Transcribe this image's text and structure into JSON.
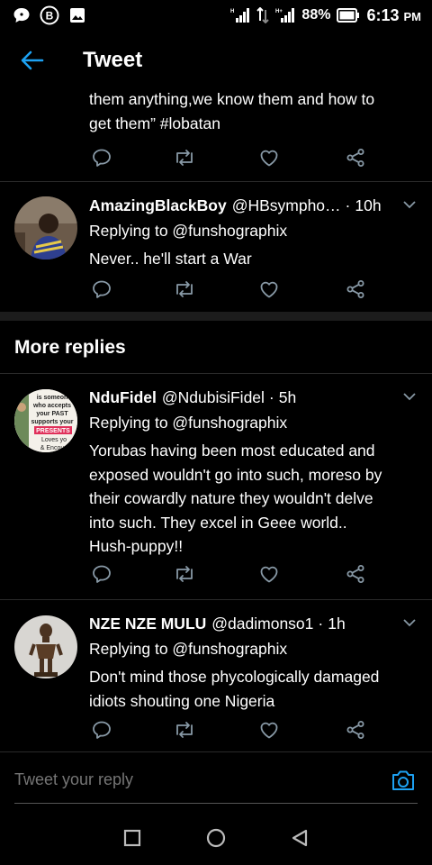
{
  "status_bar": {
    "battery_pct": "88%",
    "time": "6:13",
    "ampm": "PM"
  },
  "header": {
    "title": "Tweet"
  },
  "top_tweet": {
    "text_lines": [
      "them anything,we know them and how to",
      "get them” #lobatan"
    ]
  },
  "tweets": [
    {
      "name": "AmazingBlackBoy",
      "handle": "@HBsympho…",
      "time": "10h",
      "reply_to": "Replying to @funshographix",
      "text_lines": [
        "Never.. he'll start a War"
      ]
    },
    {
      "name": "NduFidel",
      "handle": "@NdubisiFidel",
      "time": "5h",
      "reply_to": "Replying to @funshographix",
      "text_lines": [
        "Yorubas having been most educated and",
        "exposed wouldn't go into such, moreso by",
        "their cowardly nature they wouldn't delve",
        "into such. They excel in Geee world..",
        "Hush-puppy!!"
      ],
      "avatar_text": [
        "is someon",
        "who accepts",
        "your PAST",
        "supports your",
        "PRESENTS",
        "Loves yo",
        "& Encou"
      ]
    },
    {
      "name": "NZE NZE MULU",
      "handle": "@dadimonso1",
      "time": "1h",
      "reply_to": "Replying to @funshographix",
      "text_lines": [
        "Don't mind those phycologically damaged",
        "idiots shouting one Nigeria"
      ]
    }
  ],
  "more_replies_label": "More replies",
  "reply_box": {
    "placeholder": "Tweet your reply"
  },
  "colors": {
    "accent": "#1da1f2",
    "icon_gray": "#8899a6",
    "divider": "#2a2a2a"
  }
}
